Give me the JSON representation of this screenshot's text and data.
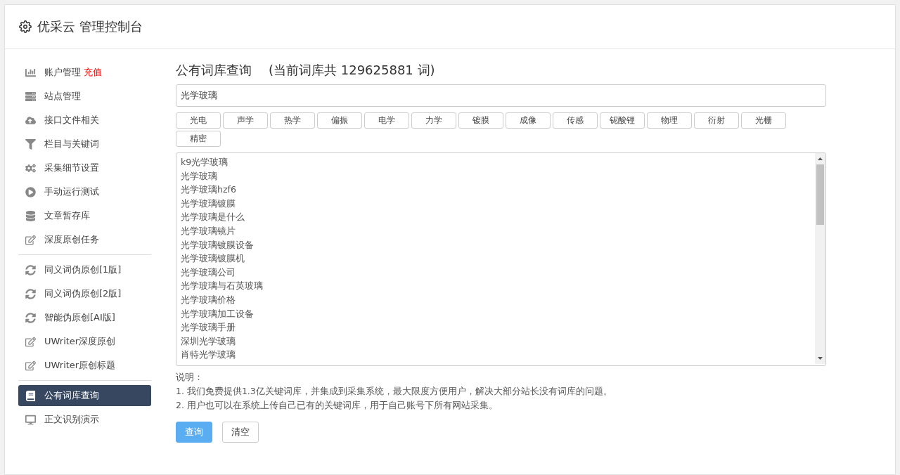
{
  "header": {
    "title": "优采云 管理控制台"
  },
  "sidebar": {
    "groups": [
      [
        {
          "label": "账户管理",
          "tag": "充值",
          "selected": false
        },
        {
          "label": "站点管理",
          "selected": false
        },
        {
          "label": "接口文件相关",
          "selected": false
        },
        {
          "label": "栏目与关键词",
          "selected": false
        },
        {
          "label": "采集细节设置",
          "selected": false
        },
        {
          "label": "手动运行测试",
          "selected": false
        },
        {
          "label": "文章暂存库",
          "selected": false
        },
        {
          "label": "深度原创任务",
          "selected": false
        }
      ],
      [
        {
          "label": "同义词伪原创[1版]",
          "selected": false
        },
        {
          "label": "同义词伪原创[2版]",
          "selected": false
        },
        {
          "label": "智能伪原创[AI版]",
          "selected": false
        },
        {
          "label": "UWriter深度原创",
          "selected": false
        },
        {
          "label": "UWriter原创标题",
          "selected": false
        }
      ],
      [
        {
          "label": "公有词库查询",
          "selected": true
        },
        {
          "label": "正文识别演示",
          "selected": false
        }
      ]
    ]
  },
  "main": {
    "title": "公有词库查询",
    "count": "(当前词库共 129625881 词)",
    "search": {
      "value": "光学玻璃"
    },
    "tags": [
      "光电",
      "声学",
      "热学",
      "偏振",
      "电学",
      "力学",
      "镀膜",
      "成像",
      "传感",
      "铌酸锂",
      "物理",
      "衍射",
      "光栅",
      "精密"
    ],
    "results": [
      "k9光学玻璃",
      "光学玻璃",
      "光学玻璃hzf6",
      "光学玻璃镀膜",
      "光学玻璃是什么",
      "光学玻璃镜片",
      "光学玻璃镀膜设备",
      "光学玻璃镀膜机",
      "光学玻璃公司",
      "光学玻璃与石英玻璃",
      "光学玻璃价格",
      "光学玻璃加工设备",
      "光学玻璃手册",
      "深圳光学玻璃",
      "肖特光学玻璃"
    ],
    "notes_title": "说明：",
    "notes": [
      "1. 我们免费提供1.3亿关键词库，并集成到采集系统，最大限度方便用户，解决大部分站长没有词库的问题。",
      "2. 用户也可以在系统上传自己已有的关键词库，用于自己账号下所有网站采集。"
    ],
    "buttons": [
      {
        "kind": "primary",
        "label": "查询"
      },
      {
        "kind": "default",
        "label": "清空"
      }
    ]
  }
}
